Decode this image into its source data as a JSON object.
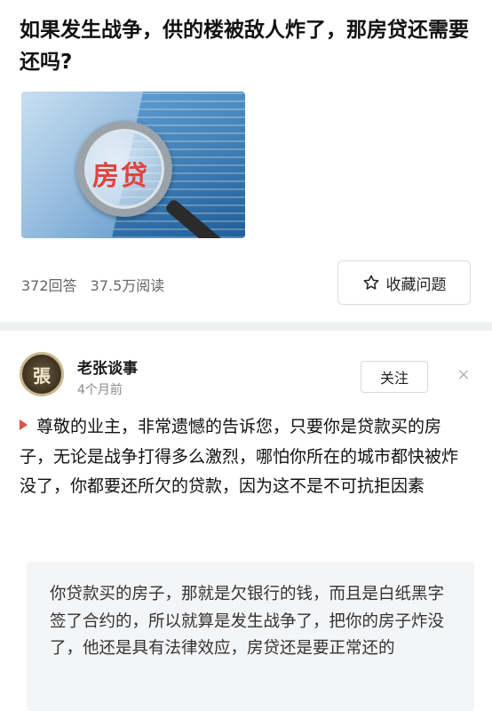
{
  "question": {
    "title": "如果发生战争，供的楼被敌人炸了，那房贷还需要还吗?",
    "image_text": "房贷",
    "answers_count": "372回答",
    "views": "37.5万阅读",
    "favorite_label": "收藏问题"
  },
  "answer": {
    "avatar_text": "張",
    "author": "老张谈事",
    "time": "4个月前",
    "follow_label": "关注",
    "close_symbol": "×",
    "body": "尊敬的业主，非常遗憾的告诉您，只要你是贷款买的房子，无论是战争打得多么激烈，哪怕你所在的城市都快被炸没了，你都要还所欠的贷款，因为这不是不可抗拒因素",
    "quote": "你贷款买的房子，那就是欠银行的钱，而且是白纸黑字签了合约的，所以就算是发生战争了，把你的房子炸没了，他还是具有法律效应，房贷还是要正常还的"
  },
  "colors": {
    "marker": "#d9534f",
    "divider": "#f0f1f3",
    "quote_bg": "#f4f5f7"
  },
  "icons": {
    "favorite": "star-outline-icon",
    "close": "close-icon"
  }
}
